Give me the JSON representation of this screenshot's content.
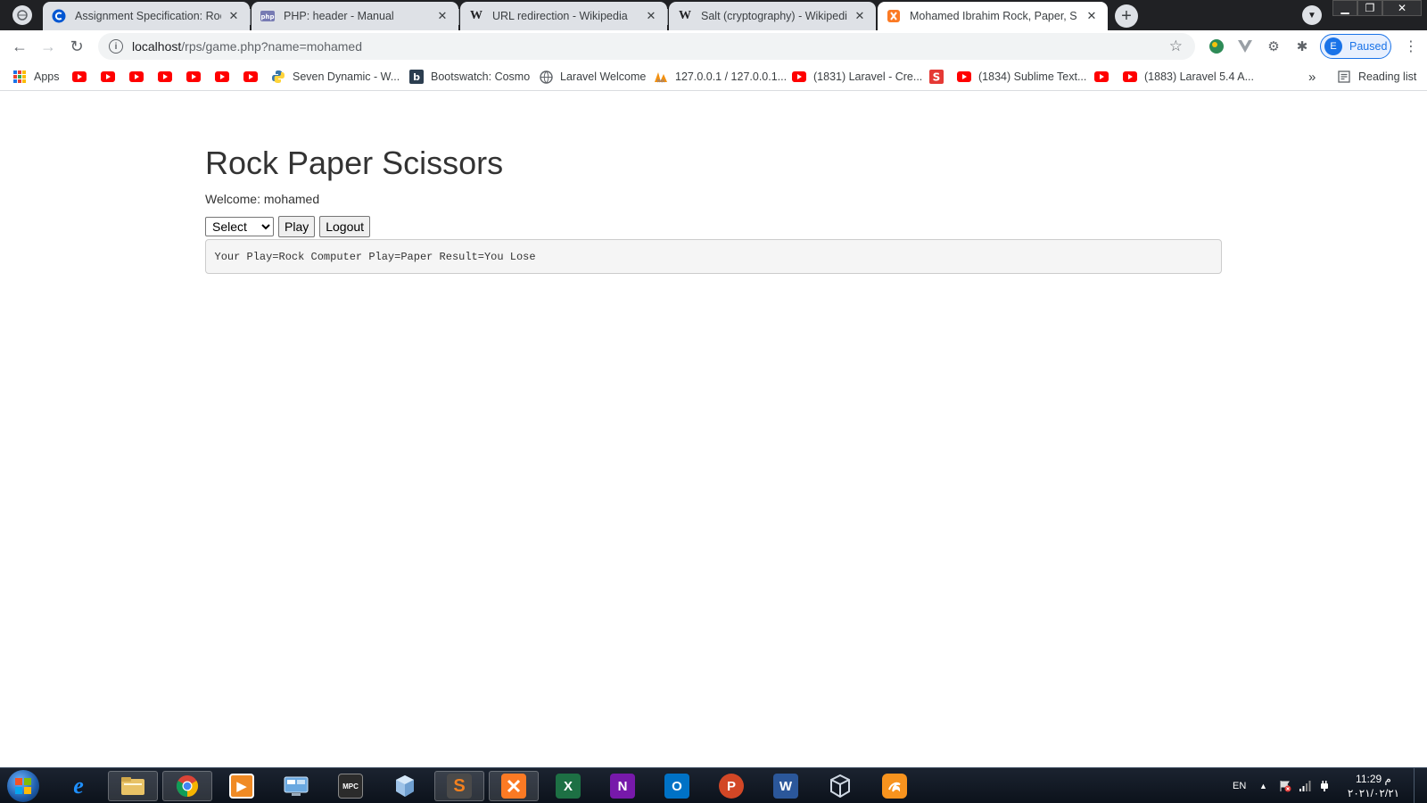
{
  "browser": {
    "tabs": [
      {
        "title": "Assignment Specification: Rock P",
        "favicon": "coursera-c-icon",
        "active": false
      },
      {
        "title": "PHP: header - Manual",
        "favicon": "php-icon",
        "active": false
      },
      {
        "title": "URL redirection - Wikipedia",
        "favicon": "wikipedia-w-icon",
        "active": false
      },
      {
        "title": "Salt (cryptography) - Wikipedia",
        "favicon": "wikipedia-w-icon",
        "active": false
      },
      {
        "title": "Mohamed Ibrahim Rock, Paper, S",
        "favicon": "xampp-icon",
        "active": true
      }
    ],
    "address_bar": {
      "host": "localhost",
      "path": "/rps/game.php?name=mohamed"
    },
    "profile": {
      "initial": "E",
      "label": "Paused"
    },
    "bookmarks": [
      {
        "label": "Apps",
        "icon": "apps-grid-icon"
      },
      {
        "label": "",
        "icon": "youtube-icon"
      },
      {
        "label": "",
        "icon": "youtube-icon"
      },
      {
        "label": "",
        "icon": "youtube-icon"
      },
      {
        "label": "",
        "icon": "youtube-icon"
      },
      {
        "label": "",
        "icon": "youtube-icon"
      },
      {
        "label": "",
        "icon": "youtube-icon"
      },
      {
        "label": "",
        "icon": "youtube-icon"
      },
      {
        "label": "Seven Dynamic - W...",
        "icon": "python-icon"
      },
      {
        "label": "Bootswatch: Cosmo",
        "icon": "bootswatch-icon"
      },
      {
        "label": "Laravel Welcome",
        "icon": "globe-icon"
      },
      {
        "label": "127.0.0.1 / 127.0.0.1...",
        "icon": "phpmyadmin-icon"
      },
      {
        "label": "(1831) Laravel - Cre...",
        "icon": "youtube-icon"
      },
      {
        "label": "",
        "icon": "sublime-s-icon"
      },
      {
        "label": "(1834) Sublime Text...",
        "icon": "youtube-icon"
      },
      {
        "label": "",
        "icon": "youtube-icon"
      },
      {
        "label": "(1883) Laravel 5.4 A...",
        "icon": "youtube-icon"
      }
    ],
    "reading_list": "Reading list",
    "overflow": "»"
  },
  "page": {
    "title": "Rock Paper Scissors",
    "welcome": "Welcome: mohamed",
    "select": {
      "selected": "Select",
      "options": [
        "Select"
      ]
    },
    "play_label": "Play",
    "logout_label": "Logout",
    "result": "Your Play=Rock Computer Play=Paper Result=You Lose"
  },
  "taskbar": {
    "language": "EN",
    "time": "11:29 م",
    "date": "٢٠٢١/٠٢/٢١",
    "apps": [
      {
        "name": "internet-explorer-icon",
        "glyph": "e",
        "color": "#1e90ff"
      },
      {
        "name": "file-explorer-icon",
        "glyph": "",
        "color": "#e8c266"
      },
      {
        "name": "chrome-icon",
        "glyph": "",
        "color": "#ffffff"
      },
      {
        "name": "media-player-icon",
        "glyph": "▶",
        "color": "#f08a24"
      },
      {
        "name": "control-panel-icon",
        "glyph": "",
        "color": "#6aa8e0"
      },
      {
        "name": "mpc-be-icon",
        "glyph": "MPC",
        "color": "#333333"
      },
      {
        "name": "virtual-box-icon",
        "glyph": "",
        "color": "#9ec3e8"
      },
      {
        "name": "sublime-text-icon",
        "glyph": "S",
        "color": "#f4811f"
      },
      {
        "name": "xampp-icon",
        "glyph": "X",
        "color": "#fb7a24"
      },
      {
        "name": "excel-icon",
        "glyph": "X",
        "color": "#1d7044"
      },
      {
        "name": "onenote-icon",
        "glyph": "N",
        "color": "#7719aa"
      },
      {
        "name": "outlook-icon",
        "glyph": "O",
        "color": "#0072c6"
      },
      {
        "name": "powerpoint-icon",
        "glyph": "P",
        "color": "#d24726"
      },
      {
        "name": "word-icon",
        "glyph": "W",
        "color": "#2b579a"
      },
      {
        "name": "virtualbox-cube-icon",
        "glyph": "",
        "color": "#cfd8e3"
      },
      {
        "name": "uc-browser-icon",
        "glyph": "",
        "color": "#f7931e"
      }
    ]
  }
}
